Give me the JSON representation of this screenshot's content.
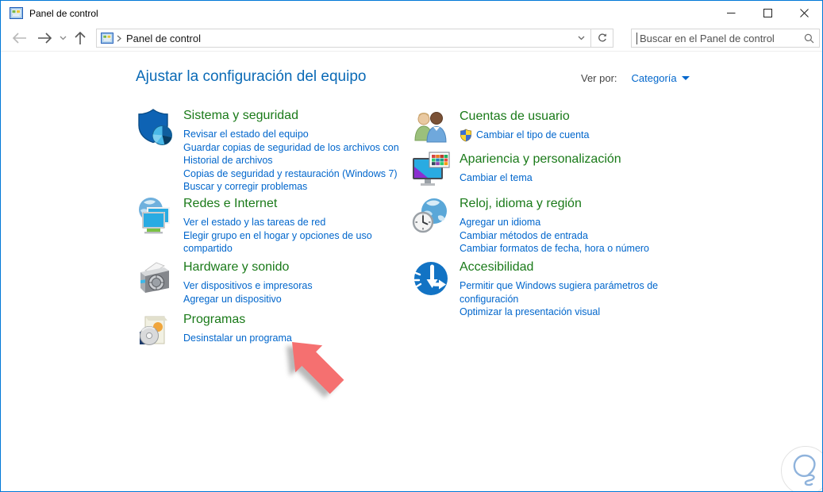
{
  "window": {
    "title": "Panel de control"
  },
  "titlebar": {
    "controls": [
      "minimize",
      "maximize",
      "close"
    ]
  },
  "toolbar": {
    "address": "Panel de control",
    "search_placeholder": "Buscar en el Panel de control",
    "icons": [
      "back-arrow",
      "forward-arrow",
      "recent-pages-chevron",
      "up-arrow",
      "control-panel-glyph",
      "breadcrumb-chevron",
      "address-dropdown-chevron",
      "refresh",
      "search-magnifier"
    ]
  },
  "header": {
    "title": "Ajustar la configuración del equipo",
    "view_by_label": "Ver por:",
    "view_by_value": "Categoría"
  },
  "categories": {
    "left": [
      {
        "title": "Sistema y seguridad",
        "icon": "security-shield",
        "links": [
          "Revisar el estado del equipo",
          "Guardar copias de seguridad de los archivos con Historial de archivos",
          "Copias de seguridad y restauración (Windows 7)",
          "Buscar y corregir problemas"
        ]
      },
      {
        "title": "Redes e Internet",
        "icon": "globe-monitors",
        "links": [
          "Ver el estado y las tareas de red",
          "Elegir grupo en el hogar y opciones de uso compartido"
        ]
      },
      {
        "title": "Hardware y sonido",
        "icon": "printer-speaker",
        "links": [
          "Ver dispositivos e impresoras",
          "Agregar un dispositivo"
        ]
      },
      {
        "title": "Programas",
        "icon": "software-box-cd",
        "links": [
          "Desinstalar un programa"
        ]
      }
    ],
    "right": [
      {
        "title": "Cuentas de usuario",
        "icon": "two-users",
        "links": [
          "Cambiar el tipo de cuenta"
        ],
        "uac_shield_on_link": true
      },
      {
        "title": "Apariencia y personalización",
        "icon": "monitor-palette",
        "links": [
          "Cambiar el tema"
        ]
      },
      {
        "title": "Reloj, idioma y región",
        "icon": "globe-clock",
        "links": [
          "Agregar un idioma",
          "Cambiar métodos de entrada",
          "Cambiar formatos de fecha, hora o número"
        ]
      },
      {
        "title": "Accesibilidad",
        "icon": "ease-of-access-circle",
        "links": [
          "Permitir que Windows sugiera parámetros de configuración",
          "Optimizar la presentación visual"
        ]
      }
    ]
  },
  "annotations": {
    "red_arrow_target": "Desinstalar un programa",
    "watermark": "lightbulb-sketch"
  },
  "colors": {
    "window_border": "#0078d7",
    "header_blue": "#0a6ab6",
    "link_blue": "#0066cc",
    "heading_green": "#1a7a19",
    "arrow_red": "#f57070",
    "uac_blue": "#3b6fd4",
    "uac_yellow": "#ffd633"
  }
}
